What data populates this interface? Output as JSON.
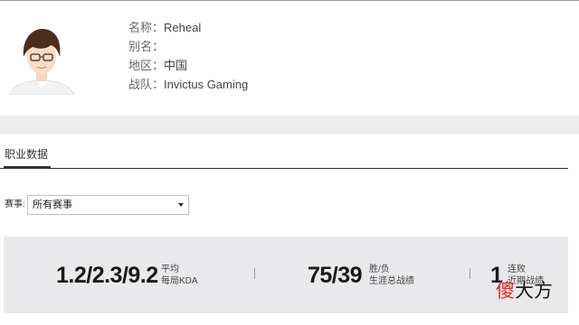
{
  "profile": {
    "name_label": "名称：",
    "name_value": "Reheal",
    "alias_label": "别名：",
    "alias_value": "",
    "region_label": "地区：",
    "region_value": "中国",
    "team_label": "战队：",
    "team_value": "Invictus Gaming"
  },
  "tabs": [
    {
      "label": "职业数据",
      "active": true
    }
  ],
  "filter": {
    "label": "赛事:",
    "selected": "所有赛事"
  },
  "stats": [
    {
      "value": "1.2/2.3/9.2",
      "desc_line1": "平均",
      "desc_line2": "每局KDA"
    },
    {
      "value": "75/39",
      "desc_line1": "胜/负",
      "desc_line2": "生涯总战绩"
    },
    {
      "value": "1",
      "desc_line1": "连败",
      "desc_line2": "近期战绩"
    }
  ],
  "watermark": {
    "char1": "傻",
    "rest": "大方"
  },
  "colors": {
    "stats_bg": "#e9e9ec",
    "band_bg": "#ececee",
    "watermark_red": "#e0241a"
  }
}
